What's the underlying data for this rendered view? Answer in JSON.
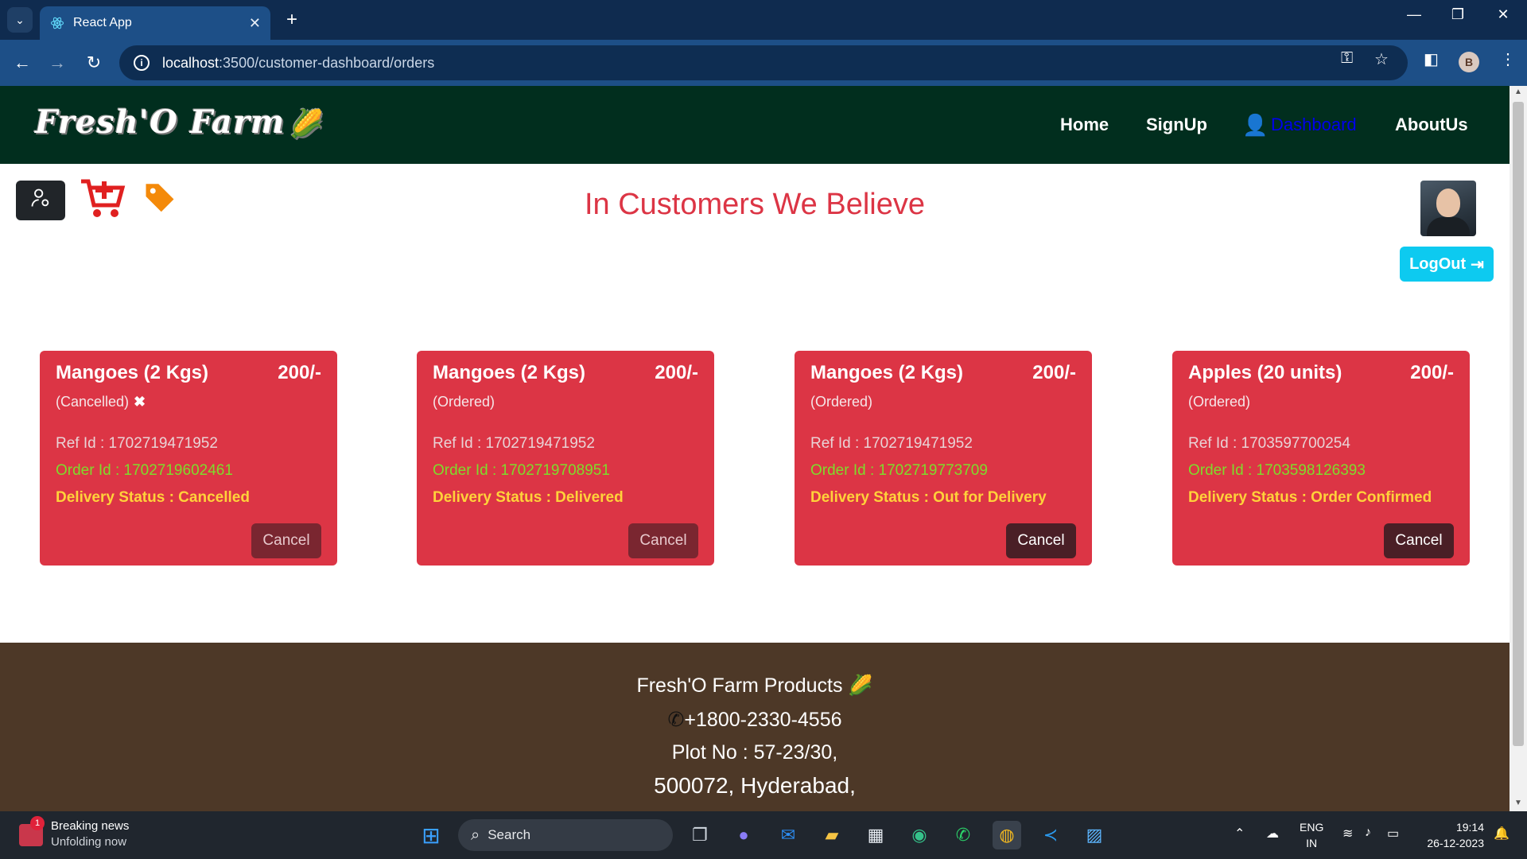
{
  "browser": {
    "tab_title": "React App",
    "url_host": "localhost",
    "url_path": ":3500/customer-dashboard/orders",
    "profile_initial": "B"
  },
  "navbar": {
    "logo": "Fresh'O Farm",
    "links": [
      "Home",
      "SignUp",
      "Dashboard",
      "AboutUs"
    ]
  },
  "dashboard": {
    "headline": "In Customers We Believe",
    "logout_label": "LogOut"
  },
  "orders": [
    {
      "name": "Mangoes (2 Kgs)",
      "price": "200/-",
      "state": "(Cancelled)",
      "ref": "Ref Id : 1702719471952",
      "order_id": "Order Id : 1702719602461",
      "delivery": "Delivery Status : Cancelled",
      "cancel_label": "Cancel",
      "cancel_enabled": false
    },
    {
      "name": "Mangoes (2 Kgs)",
      "price": "200/-",
      "state": "(Ordered)",
      "ref": "Ref Id : 1702719471952",
      "order_id": "Order Id : 1702719708951",
      "delivery": "Delivery Status : Delivered",
      "cancel_label": "Cancel",
      "cancel_enabled": false
    },
    {
      "name": "Mangoes (2 Kgs)",
      "price": "200/-",
      "state": "(Ordered)",
      "ref": "Ref Id : 1702719471952",
      "order_id": "Order Id : 1702719773709",
      "delivery": "Delivery Status : Out for Delivery",
      "cancel_label": "Cancel",
      "cancel_enabled": true
    },
    {
      "name": "Apples (20 units)",
      "price": "200/-",
      "state": "(Ordered)",
      "ref": "Ref Id : 1703597700254",
      "order_id": "Order Id : 1703598126393",
      "delivery": "Delivery Status : Order Confirmed",
      "cancel_label": "Cancel",
      "cancel_enabled": true
    }
  ],
  "footer": {
    "brand": "Fresh'O Farm Products",
    "phone": "+1800-2330-4556",
    "address_line1": "Plot No : 57-23/30,",
    "address_line2": "500072, Hyderabad,"
  },
  "taskbar": {
    "news_title": "Breaking news",
    "news_sub": "Unfolding now",
    "news_badge": "1",
    "search_label": "Search",
    "lang_line1": "ENG",
    "lang_line2": "IN",
    "time": "19:14",
    "date": "26-12-2023"
  },
  "colors": {
    "navbar_bg": "#012e1e",
    "card_bg": "#dc3545",
    "footer_bg": "#4d3827",
    "logout_bg": "#0dcaf0"
  }
}
